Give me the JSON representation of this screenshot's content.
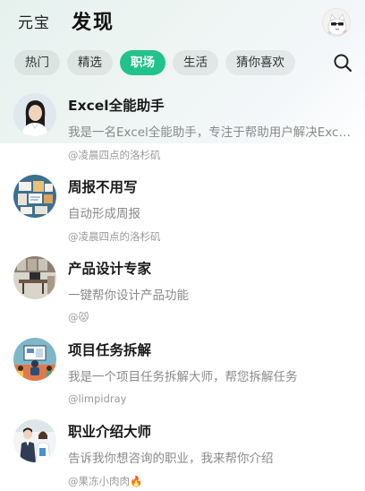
{
  "header": {
    "brand": "元宝",
    "title": "发现"
  },
  "tabs": [
    {
      "label": "热门",
      "active": false
    },
    {
      "label": "精选",
      "active": false
    },
    {
      "label": "职场",
      "active": true
    },
    {
      "label": "生活",
      "active": false
    },
    {
      "label": "猜你喜欢",
      "active": false
    }
  ],
  "search_icon": "search-icon",
  "accent_color": "#22c28b",
  "items": [
    {
      "title": "Excel全能助手",
      "description": "我是一名Excel全能助手，专注于帮助用户解决Excel相关问题",
      "author": "@凌晨四点的洛杉矶",
      "thumb": "woman-portrait"
    },
    {
      "title": "周报不用写",
      "description": "自动形成周报",
      "author": "@凌晨四点的洛杉矶",
      "thumb": "report-board"
    },
    {
      "title": "产品设计专家",
      "description": "一键帮你设计产品功能",
      "author": "@😾",
      "thumb": "design-office"
    },
    {
      "title": "项目任务拆解",
      "description": "我是一个项目任务拆解大师，帮您拆解任务",
      "author": "@limpidray",
      "thumb": "meeting-screen"
    },
    {
      "title": "职业介绍大师",
      "description": "告诉我你想咨询的职业，我来帮你介绍",
      "author": "@果冻小肉肉🔥",
      "thumb": "two-professionals"
    }
  ]
}
